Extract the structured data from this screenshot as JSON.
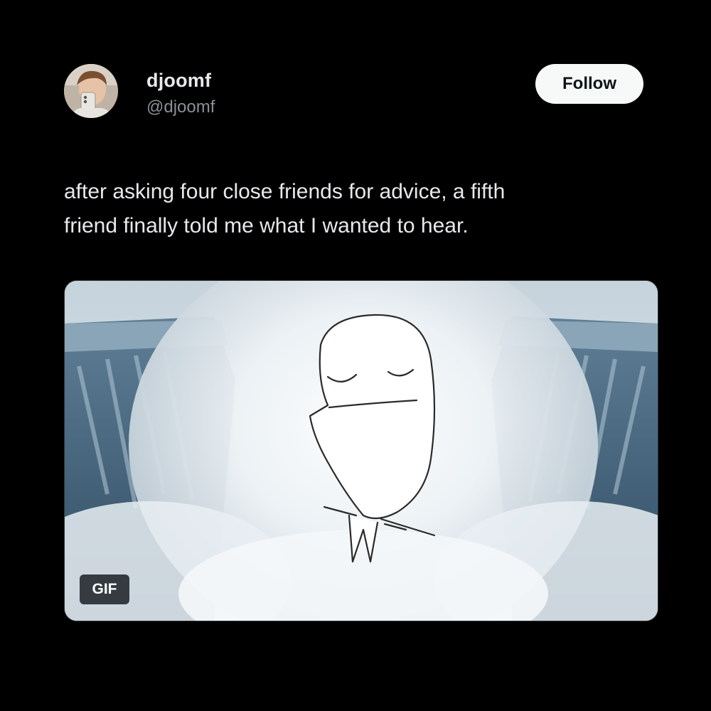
{
  "author": {
    "display_name": "djoomf",
    "handle": "@djoomf",
    "avatar_icon": "user-avatar-photo"
  },
  "follow_button": {
    "label": "Follow"
  },
  "tweet": {
    "lines": [
      "after asking four close friends for advice, a fifth",
      "friend finally told me what I wanted to hear."
    ]
  },
  "media": {
    "type": "gif",
    "badge": "GIF",
    "scene_icon": "waterfall-doodle-character"
  },
  "colors": {
    "background": "#000000",
    "text_primary": "#e7e9ea",
    "text_secondary": "#8b9096",
    "button_bg": "#f7f9f9",
    "button_text": "#0f1419"
  }
}
